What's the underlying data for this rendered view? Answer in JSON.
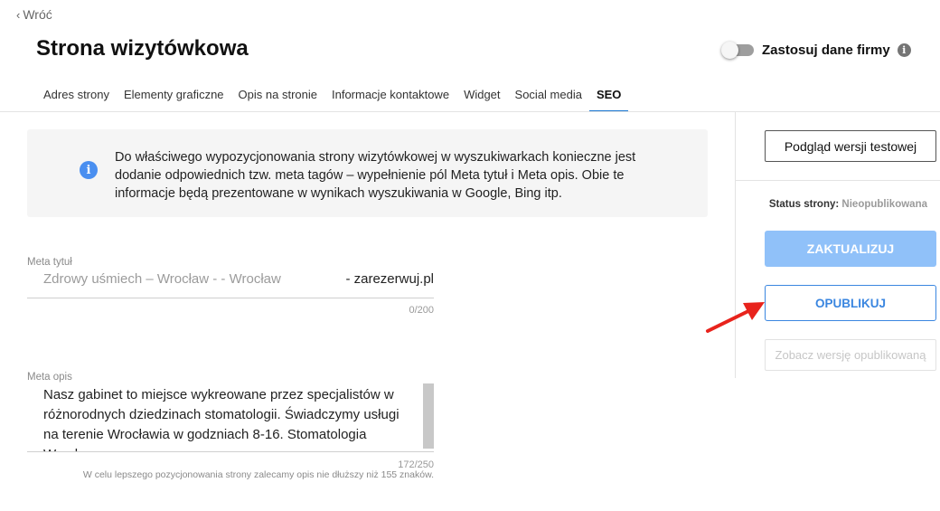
{
  "nav": {
    "back_label": "Wróć"
  },
  "header": {
    "title": "Strona wizytówkowa",
    "toggle_label": "Zastosuj dane firmy",
    "toggle_on": false
  },
  "tabs": [
    {
      "label": "Adres strony"
    },
    {
      "label": "Elementy graficzne"
    },
    {
      "label": "Opis na stronie"
    },
    {
      "label": "Informacje kontaktowe"
    },
    {
      "label": "Widget"
    },
    {
      "label": "Social media"
    },
    {
      "label": "SEO",
      "active": true
    }
  ],
  "notice": {
    "text": "Do właściwego wypozycjonowania strony wizytówkowej w wyszukiwarkach konieczne jest dodanie odpowiednich tzw. meta tagów – wypełnienie pól Meta tytuł i Meta opis. Obie te informacje będą prezentowane w wynikach wyszukiwania w Google, Bing itp."
  },
  "meta_title": {
    "label": "Meta tytuł",
    "value": "Zdrowy uśmiech – Wrocław -  - Wrocław",
    "suffix": "- zarezerwuj.pl",
    "counter": "0/200"
  },
  "meta_desc": {
    "label": "Meta opis",
    "value": "Nasz gabinet to miejsce wykreowane przez specjalistów w różnorodnych dziedzinach stomatologii. Świadczymy usługi na terenie Wrocławia w godzniach 8-16. Stomatologia Wrocław",
    "counter": "172/250",
    "hint": "W celu lepszego pozycjonowania strony zalecamy opis nie dłuższy niż 155 znaków."
  },
  "sidebar": {
    "preview_label": "Podgląd wersji testowej",
    "status_label": "Status strony:",
    "status_value": "Nieopublikowana",
    "update_label": "ZAKTUALIZUJ",
    "publish_label": "OPUBLIKUJ",
    "view_published_label": "Zobacz wersję opublikowaną"
  },
  "colors": {
    "accent": "#1976d2",
    "update_bg": "#90c1f9",
    "publish_border": "#3a86e0",
    "arrow": "#e8231c",
    "info_icon": "#4a8ff0"
  }
}
